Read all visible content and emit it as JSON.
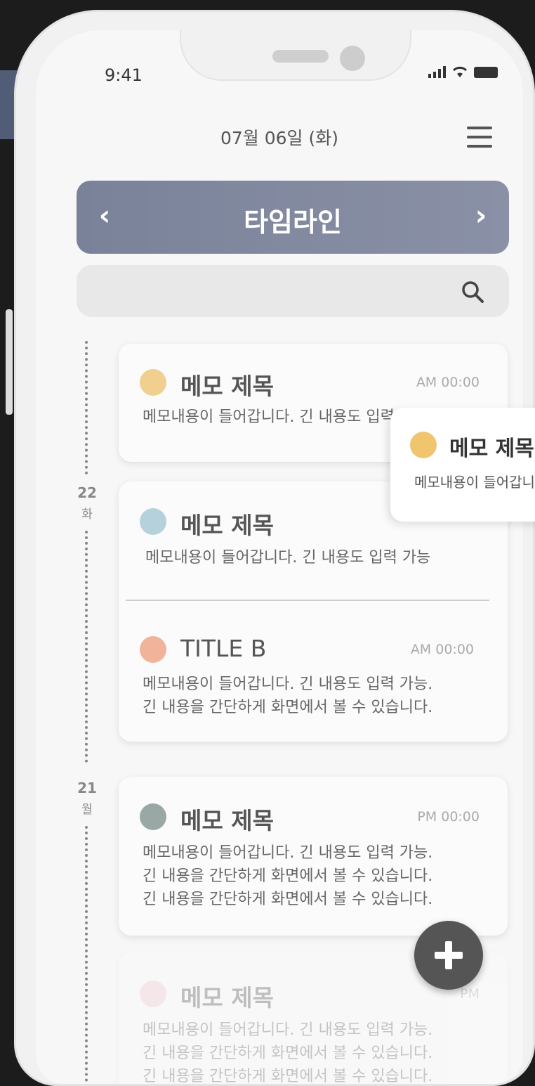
{
  "status": {
    "time": "9:41"
  },
  "header": {
    "date": "07월 06일 (화)"
  },
  "timeline": {
    "title": "타임라인"
  },
  "days": [
    {
      "day": "22",
      "weekday": "화"
    },
    {
      "day": "21",
      "weekday": "월"
    }
  ],
  "memos": [
    {
      "title": "메모 제목",
      "time": "AM 00:00",
      "color": "#f0cf8f",
      "body": "메모내용이 들어갑니다. 긴 내용도 입력 가능"
    },
    {
      "title": "메모 제목",
      "time": "",
      "color": "#b5d1dc",
      "body": "메모내용이 들어갑니다. 긴 내용도 입력 가능"
    },
    {
      "title": "TITLE B",
      "time": "AM 00:00",
      "color": "#f1b49a",
      "body1": "메모내용이 들어갑니다. 긴 내용도 입력 가능.",
      "body2": "긴 내용을 간단하게 화면에서 볼 수 있습니다."
    },
    {
      "title": "메모 제목",
      "time": "PM 00:00",
      "color": "#9aa8a5",
      "body1": "메모내용이 들어갑니다. 긴 내용도 입력 가능.",
      "body2": "긴 내용을 간단하게 화면에서 볼 수 있습니다.",
      "body3": "긴 내용을 간단하게 화면에서 볼 수 있습니다."
    },
    {
      "title": "메모 제목",
      "time": "PM",
      "color": "#f2c8d2",
      "body1": "메모내용이 들어갑니다. 긴 내용도 입력 가능.",
      "body2": "긴 내용을 간단하게 화면에서 볼 수 있습니다.",
      "body3": "긴 내용을 간단하게 화면에서 볼 수 있습니다."
    }
  ],
  "popup": {
    "title": "메모 제목",
    "body": "메모내용이 들어갑니다."
  },
  "colors": {
    "accent": "#7a829a",
    "side_tab": "#515d77",
    "fab": "#555555"
  }
}
